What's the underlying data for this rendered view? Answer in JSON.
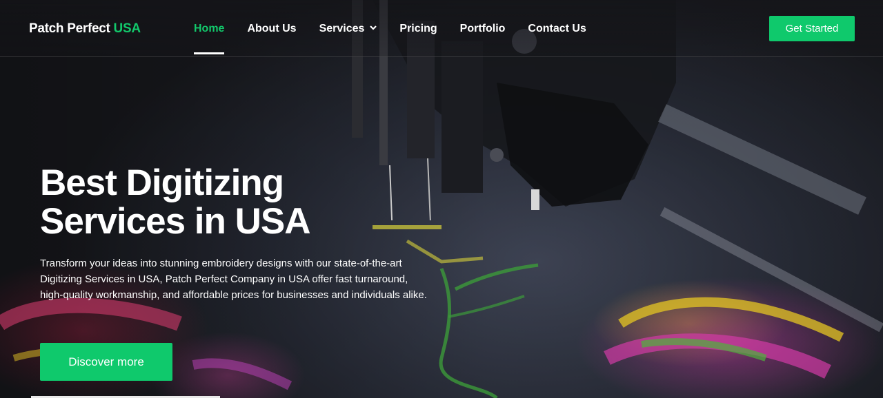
{
  "brand": {
    "name": "Patch Perfect",
    "accent": "USA"
  },
  "nav": {
    "items": [
      {
        "label": "Home",
        "active": true
      },
      {
        "label": "About Us",
        "active": false
      },
      {
        "label": "Services",
        "active": false,
        "icon": "chevron-down-icon"
      },
      {
        "label": "Pricing",
        "active": false
      },
      {
        "label": "Portfolio",
        "active": false
      },
      {
        "label": "Contact Us",
        "active": false
      }
    ],
    "cta_label": "Get Started"
  },
  "hero": {
    "title_line1": "Best Digitizing",
    "title_line2": "Services in USA",
    "description": "Transform your ideas into stunning embroidery designs with our state-of-the-art Digitizing Services in USA, Patch Perfect Company in USA offer fast turnaround, high-quality workmanship, and affordable prices for businesses and individuals alike.",
    "button_label": "Discover more"
  },
  "colors": {
    "accent": "#12c86b",
    "button": "#0fc96c",
    "text": "#ffffff"
  }
}
